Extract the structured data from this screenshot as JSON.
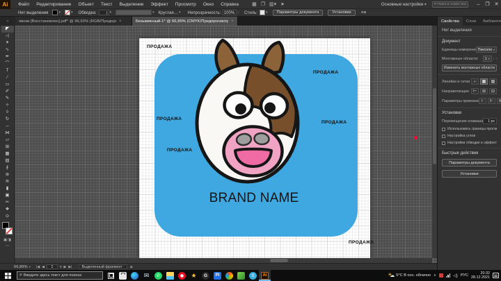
{
  "app": {
    "logo": "Ai"
  },
  "menubar": {
    "items": [
      "Файл",
      "Редактирование",
      "Объект",
      "Текст",
      "Выделение",
      "Эффект",
      "Просмотр",
      "Окно",
      "Справка"
    ],
    "workspace": "Основные настройки",
    "stock_search_placeholder": "Поиск в Adobe Stock",
    "window_controls": {
      "minimize": "–",
      "restore": "❐",
      "close": "✕"
    }
  },
  "controlbar": {
    "no_selection": "Нет выделения",
    "stroke_label": "Обводка:",
    "brush_value": "Круглая…",
    "opacity_label": "Непрозрачность:",
    "opacity_value": "100%",
    "style_label": "Стиль:",
    "doc_setup_button": "Параметры документа",
    "preferences_button": "Установки"
  },
  "tabs": [
    {
      "title": "явник [Восстановлен].pdf* @ 96,93% (RGB/Предпросмотр GPU)",
      "close": "×",
      "active": false
    },
    {
      "title": "Безымянный-1* @ 66,89% (CMYK/Предпросмотр GPU)",
      "close": "×",
      "active": true
    }
  ],
  "toolbar": {
    "tools": [
      {
        "name": "selection-tool",
        "glyph": "◤",
        "active": true
      },
      {
        "name": "direct-selection-tool",
        "glyph": "◁"
      },
      {
        "name": "magic-wand-tool",
        "glyph": "✶"
      },
      {
        "name": "lasso-tool",
        "glyph": "∿"
      },
      {
        "name": "pen-tool",
        "glyph": "✒"
      },
      {
        "name": "curvature-tool",
        "glyph": "⌒"
      },
      {
        "name": "type-tool",
        "glyph": "T"
      },
      {
        "name": "line-segment-tool",
        "glyph": "∕"
      },
      {
        "name": "rectangle-tool",
        "glyph": "▭"
      },
      {
        "name": "paintbrush-tool",
        "glyph": "✐"
      },
      {
        "name": "pencil-tool",
        "glyph": "✎"
      },
      {
        "name": "shaper-tool",
        "glyph": "✧"
      },
      {
        "name": "eraser-tool",
        "glyph": "◊"
      },
      {
        "name": "rotate-tool",
        "glyph": "↻"
      },
      {
        "name": "scale-tool",
        "glyph": "↔"
      },
      {
        "name": "width-tool",
        "glyph": "⋈"
      },
      {
        "name": "free-transform-tool",
        "glyph": "▱"
      },
      {
        "name": "perspective-grid-tool",
        "glyph": "⊞"
      },
      {
        "name": "mesh-tool",
        "glyph": "▦"
      },
      {
        "name": "gradient-tool",
        "glyph": "▧"
      },
      {
        "name": "eyedropper-tool",
        "glyph": "∮"
      },
      {
        "name": "blend-tool",
        "glyph": "⊛"
      },
      {
        "name": "symbol-sprayer-tool",
        "glyph": "≋"
      },
      {
        "name": "column-graph-tool",
        "glyph": "▮"
      },
      {
        "name": "artboard-tool",
        "glyph": "▣"
      },
      {
        "name": "slice-tool",
        "glyph": "✂"
      },
      {
        "name": "hand-tool",
        "glyph": "❖"
      },
      {
        "name": "zoom-tool",
        "glyph": "⊙"
      }
    ]
  },
  "canvas": {
    "sale_labels": [
      "ПРОДАЖА",
      "ПРОДАЖА",
      "ПРОДАЖА",
      "ПРОДАЖА",
      "ПРОДАЖА",
      "ПРОДАЖА"
    ],
    "brand_name": "BRAND NAME",
    "colors": {
      "background_blue": "#3FA8E0",
      "head_white": "#FAF8F5",
      "horn_brown": "#8C6239",
      "patch_brown": "#77502B",
      "muzzle_pink": "#F0A3C2",
      "mouth_pink": "#EF6BA4",
      "nostril_gray": "#9E9E9E",
      "outline_black": "#161616"
    }
  },
  "properties_panel": {
    "tabs": [
      "Свойства",
      "Слои",
      "Библиотеки"
    ],
    "no_selection": "Нет выделения",
    "document_section": {
      "title": "Документ",
      "units_label": "Единицы измерения:",
      "units_value": "Пиксели",
      "artboards_label": "Монтажные области:",
      "artboards_value": "1",
      "edit_artboards_button": "Изменить монтажные области"
    },
    "icon_rows": [
      {
        "label": "Линейки и сетки",
        "icons": [
          {
            "name": "rulers-icon",
            "glyph": "⌐"
          },
          {
            "name": "grid-icon",
            "glyph": "▦",
            "active": true
          },
          {
            "name": "snap-grid-icon",
            "glyph": "▩"
          }
        ]
      },
      {
        "label": "Направляющие",
        "icons": [
          {
            "name": "guides-icon",
            "glyph": "⊢"
          },
          {
            "name": "lock-guides-icon",
            "glyph": "⊞"
          },
          {
            "name": "guides-options-icon",
            "glyph": "⊟"
          }
        ]
      },
      {
        "label": "Параметры привязки",
        "icons": [
          {
            "name": "snap-point-icon",
            "glyph": "⊦"
          },
          {
            "name": "snap-pixel-icon",
            "glyph": "⊩"
          },
          {
            "name": "snap-glyph-icon",
            "glyph": "⊪"
          }
        ]
      }
    ],
    "preferences_section": {
      "title": "Установки",
      "keyboard_label": "Перемещение клавишами:",
      "keyboard_value": "1 px",
      "checkboxes": [
        "Использовать границы просмотра",
        "Настройка углов",
        "Настройки обводки и эффектов"
      ]
    },
    "quick_actions": {
      "title": "Быстрые действия",
      "doc_setup_button": "Параметры документа",
      "preferences_button": "Установки"
    }
  },
  "statusbar": {
    "zoom": "66,89%",
    "artboard_nav": "1",
    "tool": "Выделенный фрагмент"
  },
  "taskbar": {
    "search_placeholder": "Введите здесь текст для поиска",
    "apps": [
      {
        "name": "task-view",
        "type": "taskview"
      },
      {
        "name": "microsoft-store",
        "type": "store"
      },
      {
        "name": "edge",
        "type": "edge"
      },
      {
        "name": "mail",
        "type": "mail",
        "glyph": "✉"
      },
      {
        "name": "whatsapp",
        "type": "whatsapp",
        "glyph": "✆"
      },
      {
        "name": "file-explorer",
        "type": "explorer"
      },
      {
        "name": "browser-red",
        "type": "redbrowser"
      },
      {
        "name": "star-app",
        "type": "star",
        "glyph": "★"
      },
      {
        "name": "g-app",
        "type": "gapp",
        "glyph": "G"
      },
      {
        "name": "blue-app",
        "type": "blueapp",
        "glyph": "Pl"
      },
      {
        "name": "photos",
        "type": "photos"
      },
      {
        "name": "green-app",
        "type": "greenapp"
      },
      {
        "name": "skype",
        "type": "skype",
        "glyph": "S"
      },
      {
        "name": "illustrator",
        "type": "illustrator",
        "glyph": "Ai",
        "active": true
      }
    ],
    "weather": "5°C В осн. облачно",
    "language": "РУС",
    "time": "20:32",
    "date": "28.12.2021"
  }
}
